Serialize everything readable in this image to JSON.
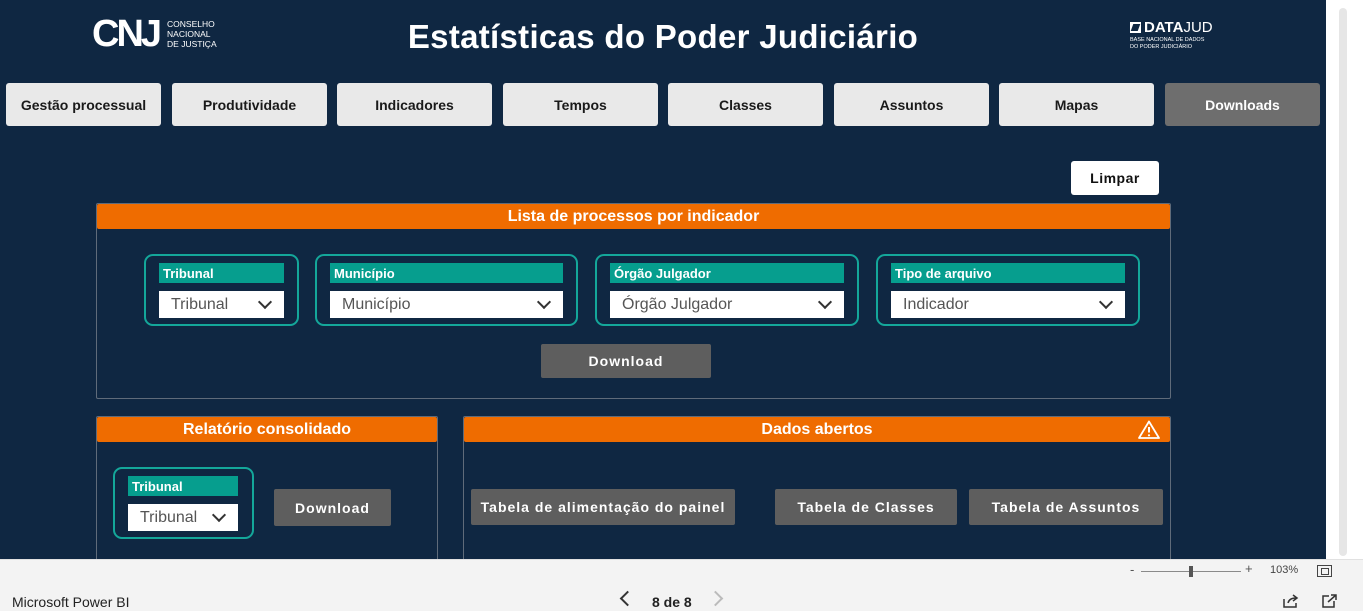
{
  "header": {
    "cnj_mark": "CNJ",
    "cnj_text": [
      "CONSELHO",
      "NACIONAL",
      "DE JUSTIÇA"
    ],
    "title": "Estatísticas do Poder Judiciário",
    "datajud_bold": "DATA",
    "datajud_light": "JUD",
    "datajud_sub": [
      "BASE NACIONAL DE DADOS",
      "DO PODER JUDICIÁRIO"
    ]
  },
  "nav": {
    "items": [
      "Gestão processual",
      "Produtividade",
      "Indicadores",
      "Tempos",
      "Classes",
      "Assuntos",
      "Mapas",
      "Downloads"
    ],
    "active": "Downloads"
  },
  "clear_button": "Limpar",
  "lista": {
    "title": "Lista de processos por indicador",
    "slicers": [
      {
        "label": "Tribunal",
        "value": "Tribunal"
      },
      {
        "label": "Município",
        "value": "Município"
      },
      {
        "label": "Órgão Julgador",
        "value": "Órgão Julgador"
      },
      {
        "label": "Tipo de arquivo",
        "value": "Indicador"
      }
    ],
    "download": "Download"
  },
  "relatorio": {
    "title": "Relatório consolidado",
    "slicer": {
      "label": "Tribunal",
      "value": "Tribunal"
    },
    "download": "Download"
  },
  "dados": {
    "title": "Dados abertos",
    "buttons": [
      "Tabela de alimentação do painel",
      "Tabela de Classes",
      "Tabela de Assuntos"
    ],
    "icon": "warning-icon"
  },
  "zoom": {
    "minus": "-",
    "plus": "+",
    "percent": "103%"
  },
  "footer": {
    "brand": "Microsoft Power BI",
    "page": "8 de 8"
  },
  "colors": {
    "background": "#0f2742",
    "accent": "#ef6c00",
    "teal": "#069e8e",
    "button": "#5e5e5e"
  }
}
